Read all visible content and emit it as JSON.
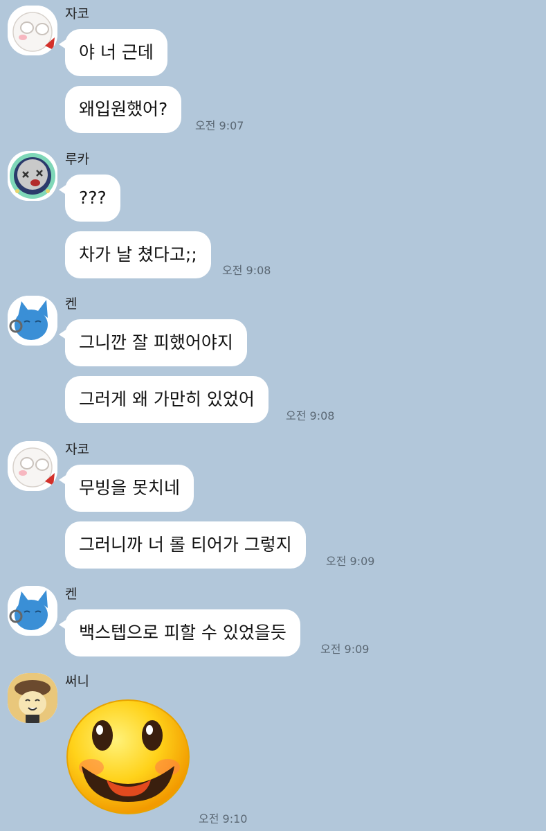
{
  "messages": [
    {
      "sender": "자코",
      "bubbles": [
        "야 너 근데",
        "왜입원했어?"
      ],
      "time": "오전 9:07"
    },
    {
      "sender": "루카",
      "bubbles": [
        "???",
        "차가 날 쳤다고;;"
      ],
      "time": "오전 9:08"
    },
    {
      "sender": "켄",
      "bubbles": [
        "그니깐 잘 피했어야지",
        "그러게 왜 가만히 있었어"
      ],
      "time": "오전 9:08"
    },
    {
      "sender": "자코",
      "bubbles": [
        "무빙을 못치네",
        "그러니까 너 롤 티어가 그렇지"
      ],
      "time": "오전 9:09"
    },
    {
      "sender": "켄",
      "bubbles": [
        "백스텝으로 피할 수 있었을듯"
      ],
      "time": "오전 9:09"
    },
    {
      "sender": "써니",
      "bubbles": [],
      "emoticon": "smiley-emoticon",
      "time": "오전 9:10"
    }
  ],
  "colors": {
    "background": "#b2c7da",
    "bubble": "#ffffff",
    "timestamp": "#5a6773"
  }
}
